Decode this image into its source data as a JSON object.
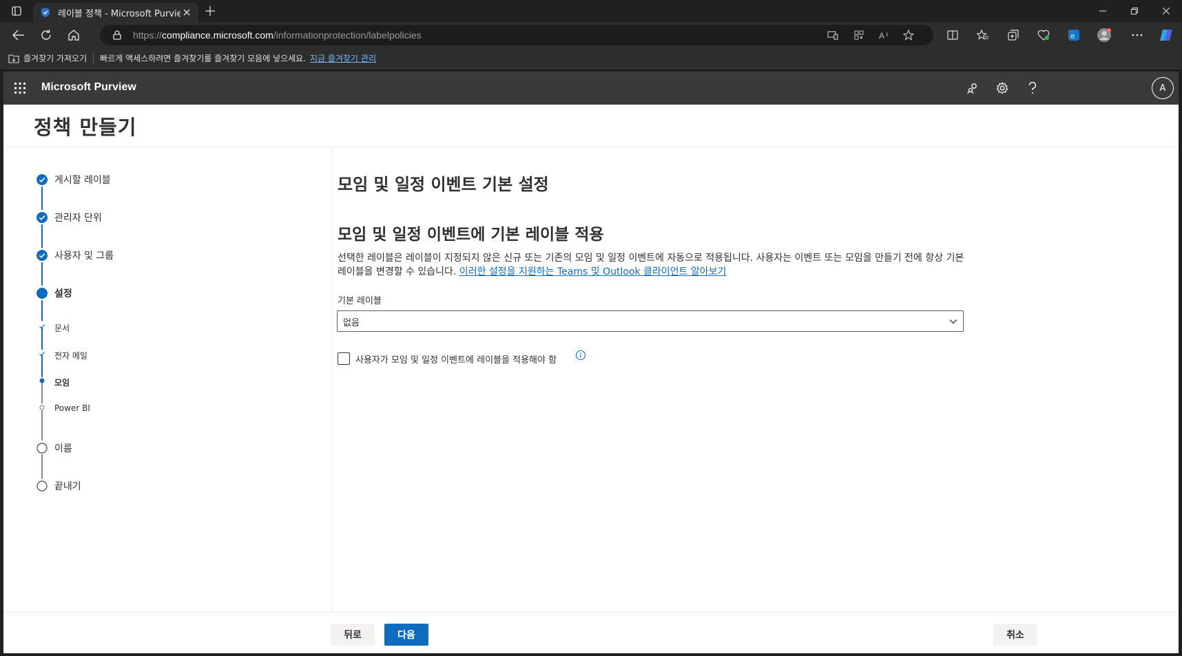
{
  "browser": {
    "tab_title": "레이블 정책 - Microsoft Purview",
    "url_scheme": "https://",
    "url_host": "compliance.microsoft.com",
    "url_path": "/informationprotection/labelpolicies",
    "favorites_import": "즐겨찾기 가져오기",
    "favorites_prompt": "빠르게 액세스하려면 즐겨찾기를 즐겨찾기 모음에 넣으세요.",
    "favorites_manage_link": "지금 즐겨찾기 관리"
  },
  "suite": {
    "brand": "Microsoft Purview",
    "avatar_initial": "A"
  },
  "page": {
    "title": "정책 만들기"
  },
  "wizard": {
    "steps": [
      {
        "label": "게시할 레이블",
        "state": "done"
      },
      {
        "label": "관리자 단위",
        "state": "done"
      },
      {
        "label": "사용자 및 그룹",
        "state": "done"
      },
      {
        "label": "설정",
        "state": "current"
      },
      {
        "label": "이름",
        "state": "pending"
      },
      {
        "label": "끝내기",
        "state": "pending"
      }
    ],
    "substeps": [
      {
        "label": "문서",
        "state": "done"
      },
      {
        "label": "전자 메일",
        "state": "done"
      },
      {
        "label": "모임",
        "state": "current"
      },
      {
        "label": "Power BI",
        "state": "pending"
      }
    ]
  },
  "content": {
    "heading": "모임 및 일정 이벤트 기본 설정",
    "subheading": "모임 및 일정 이벤트에 기본 레이블 적용",
    "description": "선택한 레이블은 레이블이 지정되지 않은 신규 또는 기존의 모임 및 일정 이벤트에 자동으로 적용됩니다. 사용자는 이벤트 또는 모임을 만들기 전에 항상 기본 레이블을 변경할 수 있습니다.",
    "learn_more_link": "이러한 설정을 지원하는 Teams 및 Outlook 클라이언트 알아보기",
    "default_label_field": "기본 레이블",
    "default_label_value": "없음",
    "require_label_checkbox": "사용자가 모임 및 일정 이벤트에 레이블을 적용해야 함",
    "require_label_checked": false
  },
  "footer": {
    "back": "뒤로",
    "next": "다음",
    "cancel": "취소"
  },
  "colors": {
    "accent": "#0f6cbd",
    "suite_bar": "#3b3a39",
    "browser_dark": "#202020"
  }
}
